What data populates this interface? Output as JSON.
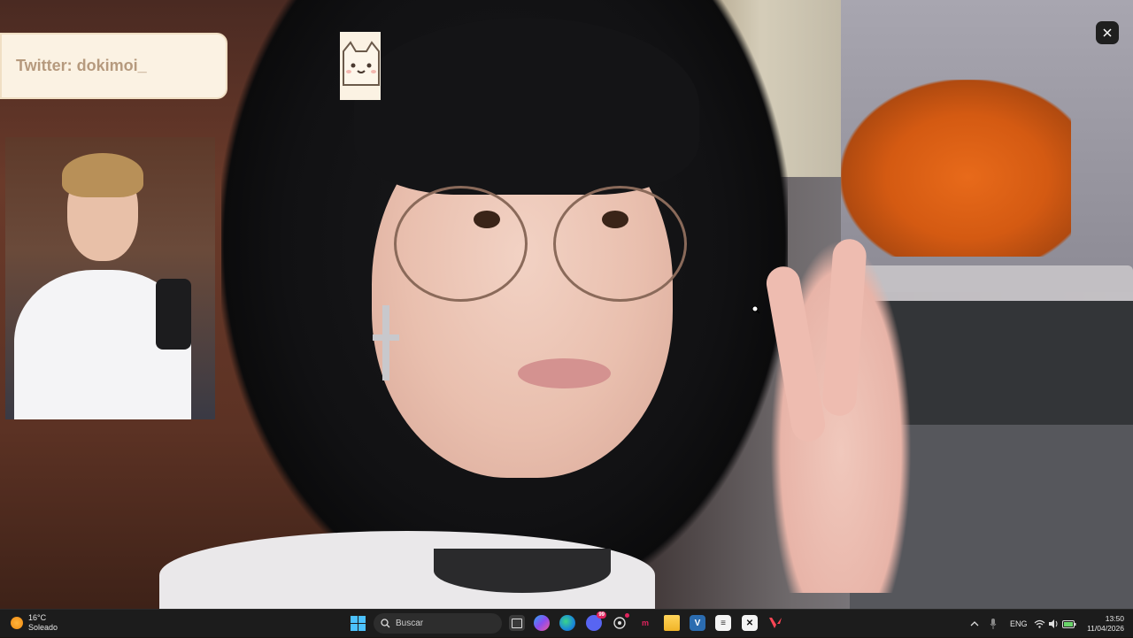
{
  "overlay": {
    "twitter_text": "Twitter: dokimoi_"
  },
  "taskbar": {
    "weather_temp": "16°C",
    "weather_desc": "Soleado",
    "search_placeholder": "Buscar",
    "language": "ENG",
    "time": "13:50",
    "date": "11/04/2026",
    "icons": [
      "windows-start-icon",
      "task-view-icon",
      "copilot-icon",
      "edge-icon",
      "discord-icon",
      "chatgpt-icon",
      "app-red-icon",
      "file-explorer-icon",
      "visual-studio-icon",
      "notepad-icon",
      "capcut-icon",
      "valorant-icon"
    ],
    "discord_badge": "99"
  },
  "colors": {
    "taskbar_bg": "#1c1c1c",
    "banner_bg": "#fbf2e3",
    "banner_text": "#b69a7e",
    "accent_orange": "#e86a1a"
  }
}
